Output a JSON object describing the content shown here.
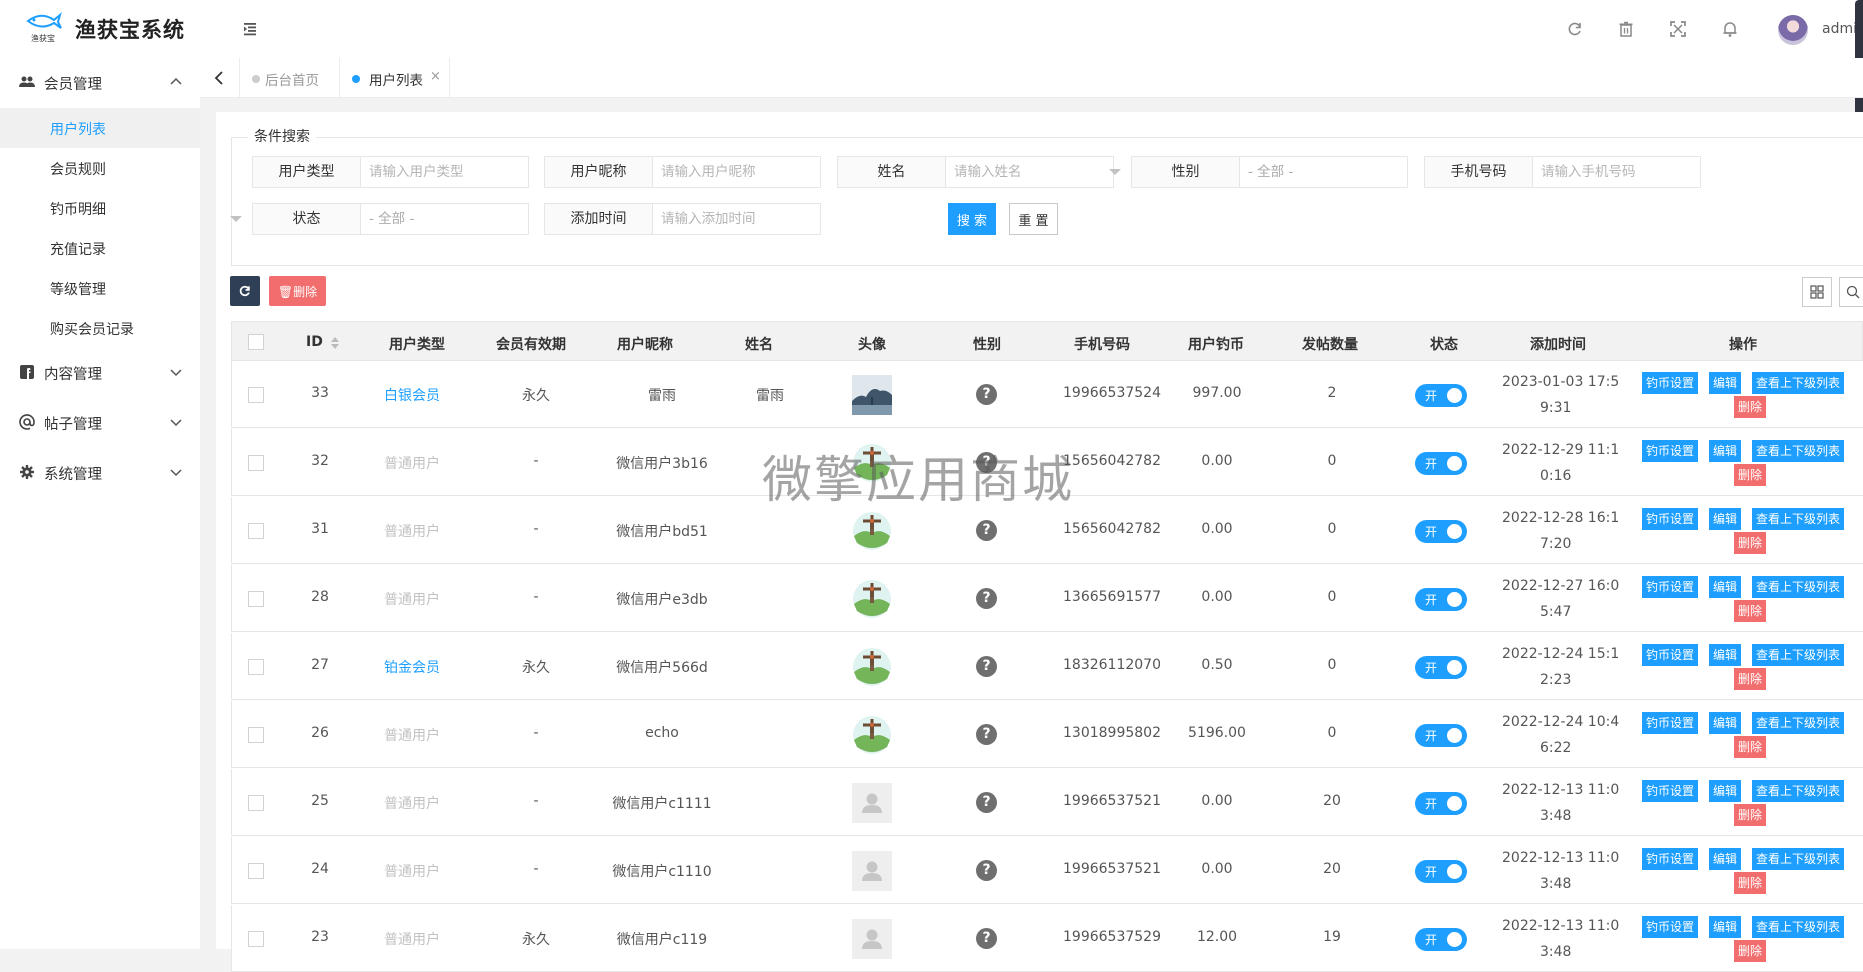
{
  "app": {
    "title": "渔获宝系统",
    "logo_text": "渔获宝"
  },
  "header": {
    "user": "admin"
  },
  "sidebar": {
    "groups": [
      {
        "label": "会员管理",
        "expanded": true
      },
      {
        "label": "内容管理",
        "expanded": false
      },
      {
        "label": "帖子管理",
        "expanded": false
      },
      {
        "label": "系统管理",
        "expanded": false
      }
    ],
    "items": [
      {
        "label": "用户列表",
        "active": true
      },
      {
        "label": "会员规则"
      },
      {
        "label": "钓币明细"
      },
      {
        "label": "充值记录"
      },
      {
        "label": "等级管理"
      },
      {
        "label": "购买会员记录"
      }
    ]
  },
  "tabs": [
    {
      "label": "后台首页",
      "active": false
    },
    {
      "label": "用户列表",
      "active": true,
      "close": "×"
    }
  ],
  "search": {
    "legend": "条件搜索",
    "fields": [
      {
        "label": "用户类型",
        "placeholder": "请输入用户类型"
      },
      {
        "label": "用户昵称",
        "placeholder": "请输入用户昵称"
      },
      {
        "label": "姓名",
        "placeholder": "请输入姓名"
      },
      {
        "label": "性别",
        "value": "- 全部 -"
      },
      {
        "label": "手机号码",
        "placeholder": "请输入手机号码"
      },
      {
        "label": "状态",
        "value": "- 全部 -"
      },
      {
        "label": "添加时间",
        "placeholder": "请输入添加时间"
      }
    ],
    "search_btn": "搜 索",
    "reset_btn": "重 置"
  },
  "toolbar": {
    "delete_btn": "删除"
  },
  "table": {
    "headers": [
      "ID",
      "用户类型",
      "会员有效期",
      "用户昵称",
      "姓名",
      "头像",
      "性别",
      "手机号码",
      "用户钓币",
      "发帖数量",
      "状态",
      "添加时间",
      "操作"
    ],
    "status_on": "开",
    "gender_unknown": "?",
    "actions": [
      "钓币设置",
      "编辑",
      "查看上下级列表",
      "删除"
    ],
    "rows": [
      {
        "id": "33",
        "type": "白银会员",
        "vip": true,
        "expire": "永久",
        "nick": "雷雨",
        "name": "雷雨",
        "avatar": "photo",
        "phone": "19966537524",
        "coins": "997.00",
        "posts": "2",
        "date1": "2023-01-03 17:5",
        "date2": "9:31"
      },
      {
        "id": "32",
        "type": "普通用户",
        "vip": false,
        "expire": "-",
        "nick": "微信用户3b16",
        "name": "",
        "avatar": "cartoon",
        "phone": "15656042782",
        "coins": "0.00",
        "posts": "0",
        "date1": "2022-12-29 11:1",
        "date2": "0:16"
      },
      {
        "id": "31",
        "type": "普通用户",
        "vip": false,
        "expire": "-",
        "nick": "微信用户bd51",
        "name": "",
        "avatar": "cartoon",
        "phone": "15656042782",
        "coins": "0.00",
        "posts": "0",
        "date1": "2022-12-28 16:1",
        "date2": "7:20"
      },
      {
        "id": "28",
        "type": "普通用户",
        "vip": false,
        "expire": "-",
        "nick": "微信用户e3db",
        "name": "",
        "avatar": "cartoon",
        "phone": "13665691577",
        "coins": "0.00",
        "posts": "0",
        "date1": "2022-12-27 16:0",
        "date2": "5:47"
      },
      {
        "id": "27",
        "type": "铂金会员",
        "vip": true,
        "expire": "永久",
        "nick": "微信用户566d",
        "name": "",
        "avatar": "cartoon",
        "phone": "18326112070",
        "coins": "0.50",
        "posts": "0",
        "date1": "2022-12-24 15:1",
        "date2": "2:23"
      },
      {
        "id": "26",
        "type": "普通用户",
        "vip": false,
        "expire": "-",
        "nick": "echo",
        "name": "",
        "avatar": "cartoon",
        "phone": "13018995802",
        "coins": "5196.00",
        "posts": "0",
        "date1": "2022-12-24 10:4",
        "date2": "6:22"
      },
      {
        "id": "25",
        "type": "普通用户",
        "vip": false,
        "expire": "-",
        "nick": "微信用户c1111",
        "name": "",
        "avatar": "default",
        "phone": "19966537521",
        "coins": "0.00",
        "posts": "20",
        "date1": "2022-12-13 11:0",
        "date2": "3:48"
      },
      {
        "id": "24",
        "type": "普通用户",
        "vip": false,
        "expire": "-",
        "nick": "微信用户c1110",
        "name": "",
        "avatar": "default",
        "phone": "19966537521",
        "coins": "0.00",
        "posts": "20",
        "date1": "2022-12-13 11:0",
        "date2": "3:48"
      },
      {
        "id": "23",
        "type": "普通用户",
        "vip": false,
        "expire": "永久",
        "nick": "微信用户c119",
        "name": "",
        "avatar": "default",
        "phone": "19966537529",
        "coins": "12.00",
        "posts": "19",
        "date1": "2022-12-13 11:0",
        "date2": "3:48"
      }
    ]
  },
  "watermark": "微擎应用商城",
  "colors": {
    "primary": "#1E9FFF",
    "danger": "#f26d6d",
    "dark": "#2F4056",
    "vip_text": "#1E9FFF",
    "normal_user_text": "#c2c2c2"
  }
}
